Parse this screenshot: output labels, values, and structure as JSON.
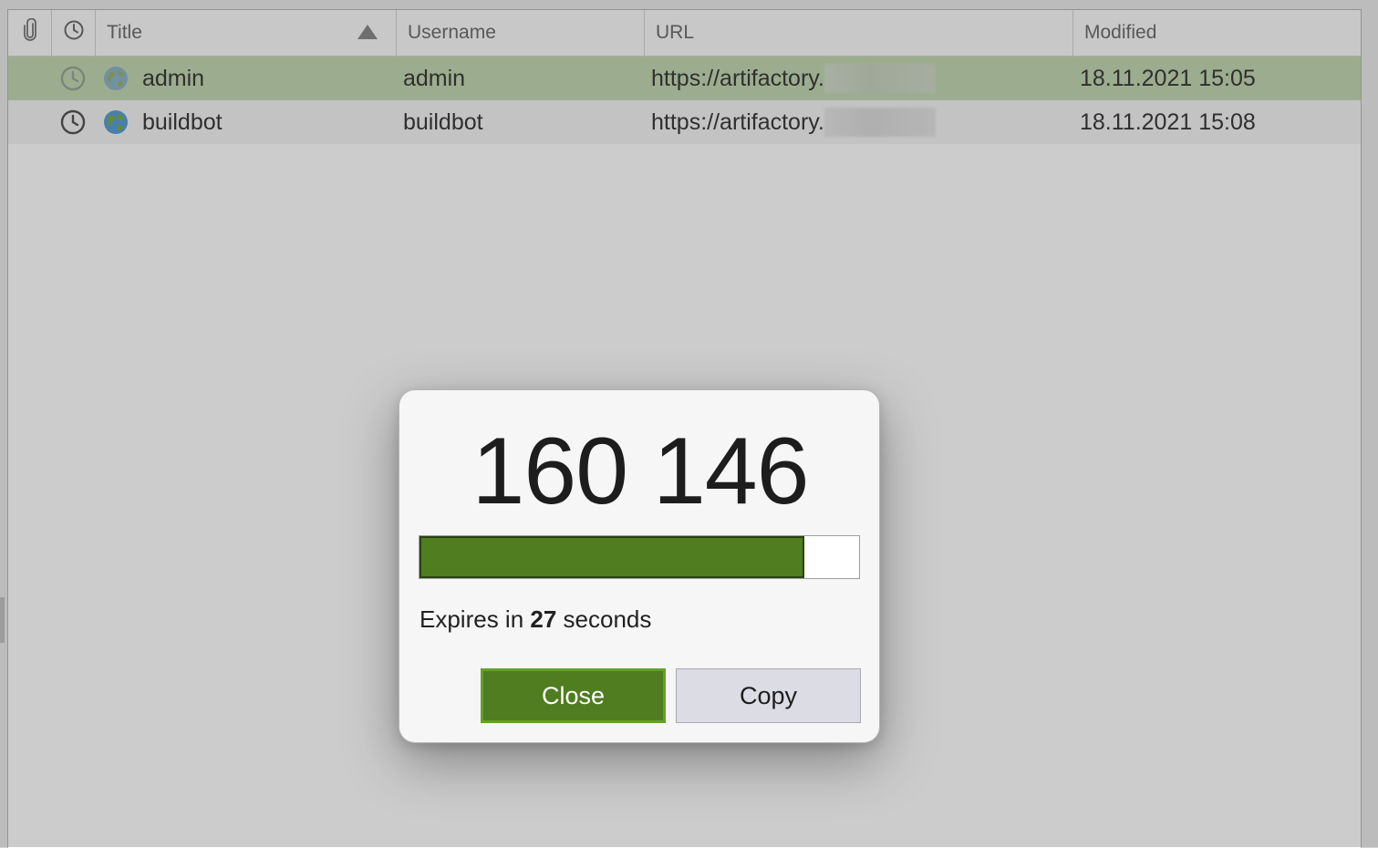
{
  "table": {
    "columns": [
      {
        "key": "attachment",
        "icon": "paperclip-icon"
      },
      {
        "key": "expiry",
        "icon": "clock-icon"
      },
      {
        "key": "title",
        "label": "Title",
        "sorted": "ascending"
      },
      {
        "key": "username",
        "label": "Username"
      },
      {
        "key": "url",
        "label": "URL"
      },
      {
        "key": "modified",
        "label": "Modified"
      }
    ],
    "rows": [
      {
        "title": "admin",
        "username": "admin",
        "url": "https://artifactory.",
        "modified": "18.11.2021 15:05",
        "selected": true
      },
      {
        "title": "buildbot",
        "username": "buildbot",
        "url": "https://artifactory.",
        "modified": "18.11.2021 15:08",
        "selected": false
      }
    ]
  },
  "dialog": {
    "code": "160 146",
    "progress_fraction": 0.875,
    "expires_prefix": "Expires in ",
    "expires_seconds": "27",
    "expires_suffix": " seconds",
    "close_label": "Close",
    "copy_label": "Copy"
  },
  "colors": {
    "accent_green": "#4f7d1f",
    "selected_row": "#c3d9b3"
  }
}
